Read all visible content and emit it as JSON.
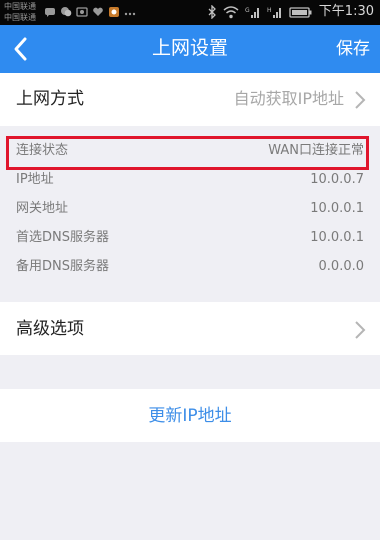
{
  "status_bar": {
    "carrier_1": "中国联通",
    "carrier_2": "中国联通",
    "notification_icons": [
      "message-icon",
      "chat-icon",
      "photo-icon",
      "heart-icon",
      "app-icon",
      "more-icon"
    ],
    "status_icons": [
      "bluetooth-icon",
      "wifi-icon",
      "signal-icon",
      "signal-icon",
      "battery-icon"
    ],
    "time": "下午1:30"
  },
  "nav": {
    "title": "上网设置",
    "save_label": "保存"
  },
  "internet_mode": {
    "label": "上网方式",
    "value": "自动获取IP地址"
  },
  "info": [
    {
      "label": "连接状态",
      "value": "WAN口连接正常"
    },
    {
      "label": "IP地址",
      "value": "10.0.0.7"
    },
    {
      "label": "网关地址",
      "value": "10.0.0.1"
    },
    {
      "label": "首选DNS服务器",
      "value": "10.0.0.1"
    },
    {
      "label": "备用DNS服务器",
      "value": "0.0.0.0"
    }
  ],
  "advanced": {
    "label": "高级选项"
  },
  "refresh": {
    "label": "更新IP地址"
  },
  "colors": {
    "nav_bg": "#2f8bf0",
    "highlight_border": "#e0152c",
    "link_text": "#3d8ee8",
    "page_bg": "#efeff4"
  }
}
